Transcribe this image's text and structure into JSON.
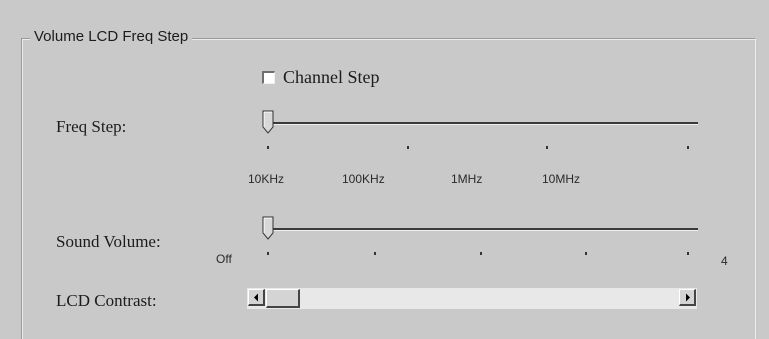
{
  "group": {
    "title": "Volume LCD Freq Step"
  },
  "channel_step": {
    "label": "Channel Step",
    "checked": false
  },
  "freq_step": {
    "label": "Freq Step:",
    "tick_labels": [
      "10KHz",
      "100KHz",
      "1MHz",
      "10MHz"
    ],
    "value_index": 0
  },
  "sound_volume": {
    "label": "Sound Volume:",
    "min_label": "Off",
    "max_label": "4",
    "value": 0
  },
  "lcd_contrast": {
    "label": "LCD Contrast:",
    "value_fraction": 0.0
  },
  "icons": {
    "left_arrow": "triangle-left-icon",
    "right_arrow": "triangle-right-icon",
    "checkbox": "checkbox-icon"
  }
}
